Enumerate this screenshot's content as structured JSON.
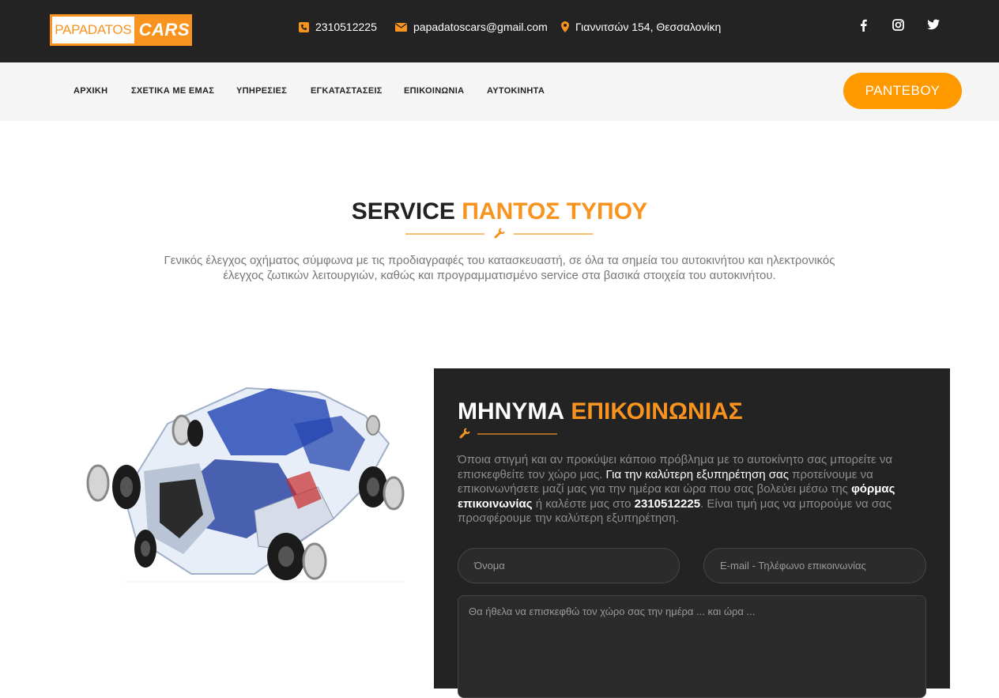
{
  "header": {
    "logo": {
      "left": "PAPADATOS",
      "right": "CARS"
    },
    "phone": "2310512225",
    "email": "papadatoscars@gmail.com",
    "address": "Γιαννιτσών 154, Θεσσαλονίκη",
    "social": [
      "facebook-icon",
      "instagram-icon",
      "twitter-icon"
    ]
  },
  "nav": {
    "items": [
      "ΑΡΧΙΚΗ",
      "ΣΧΕΤΙΚΑ ΜΕ ΕΜΑΣ",
      "ΥΠΗΡΕΣΙΕΣ",
      "ΕΓΚΑΤΑΣΤΑΣΕΙΣ",
      "ΕΠΙΚΟΙΝΩΝΙΑ",
      "ΑΥΤΟΚΙΝΗΤΑ"
    ],
    "cta": "ΡΑΝΤΕΒΟΥ"
  },
  "service": {
    "title_main": "SERVICE",
    "title_accent": "ΠΑΝΤΟΣ ΤΥΠΟΥ",
    "text": "Γενικός έλεγχος οχήματος σύμφωνα με τις προδιαγραφές του κατασκευαστή, σε όλα τα σημεία του αυτοκινήτου και ηλεκτρονικός έλεγχος ζωτικών λειτουργιών, καθώς και προγραμματισμένο service στα βασικά στοιχεία του αυτοκινήτου."
  },
  "contact_form": {
    "title_main": "ΜΗΝΥΜΑ",
    "title_accent": "ΕΠΙΚΟΙΝΩΝΙΑΣ",
    "text_1": "Όποια στιγμή και αν προκύψει κάποιο πρόβλημα με το αυτοκίνητο σας μπορείτε να επισκεφθείτε τον χώρο μας.",
    "text_2": "Για την καλύτερη εξυπηρέτηση σας",
    "text_3": "προτείνουμε να επικοινωνήσετε μαζί μας για την ημέρα και ώρα που σας βολεύει μέσω της",
    "text_4": "φόρμας επικοινωνίας",
    "text_5": "ή καλέστε μας στο",
    "text_6": "2310512225",
    "text_7": ". Είναι τιμή μας να μπορούμε να σας προσφέρουμε την καλύτερη εξυπηρέτηση.",
    "name_placeholder": "Όνομα",
    "contact_placeholder": "E-mail - Τηλέφωνο επικοινωνίας",
    "message_placeholder": "Θα ήθελα να επισκεφθώ τον χώρο σας την ημέρα ... και ώρα ..."
  },
  "colors": {
    "accent": "#f7931e",
    "dark": "#232323",
    "nav_bg": "#f5f5f5"
  }
}
